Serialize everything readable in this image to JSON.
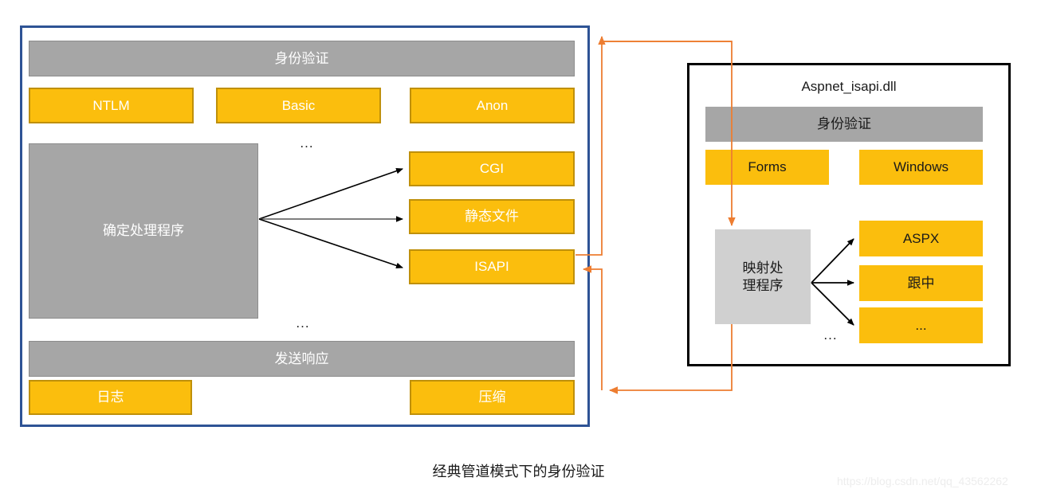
{
  "caption": "经典管道模式下的身份验证",
  "watermark": "https://blog.csdn.net/qq_43562262",
  "colors": {
    "panel_border_blue": "#2E5395",
    "panel_border_black": "#000000",
    "gray": "#A6A6A6",
    "gray_light": "#D0D0D0",
    "yellow": "#FBBE0D",
    "yellow_border": "#BF900A",
    "connector_orange": "#ED7D31",
    "arrow_black": "#000000"
  },
  "left_panel": {
    "auth_header": "身份验证",
    "auth_methods": [
      "NTLM",
      "Basic",
      "Anon"
    ],
    "ellipsis_after_auth": "...",
    "handler_box": "确定处理程序",
    "handler_targets": [
      "CGI",
      "静态文件",
      "ISAPI"
    ],
    "ellipsis_after_handlers": "...",
    "response_header": "发送响应",
    "response_items": [
      "日志",
      "压缩"
    ]
  },
  "right_panel": {
    "title": "Aspnet_isapi.dll",
    "auth_header": "身份验证",
    "auth_methods": [
      "Forms",
      "Windows"
    ],
    "mapping_box": "映射处\n理程序",
    "mapping_box_line1": "映射处",
    "mapping_box_line2": "理程序",
    "ellipsis_near_mapping": "...",
    "mapping_targets": [
      "ASPX",
      "跟中",
      "..."
    ]
  }
}
